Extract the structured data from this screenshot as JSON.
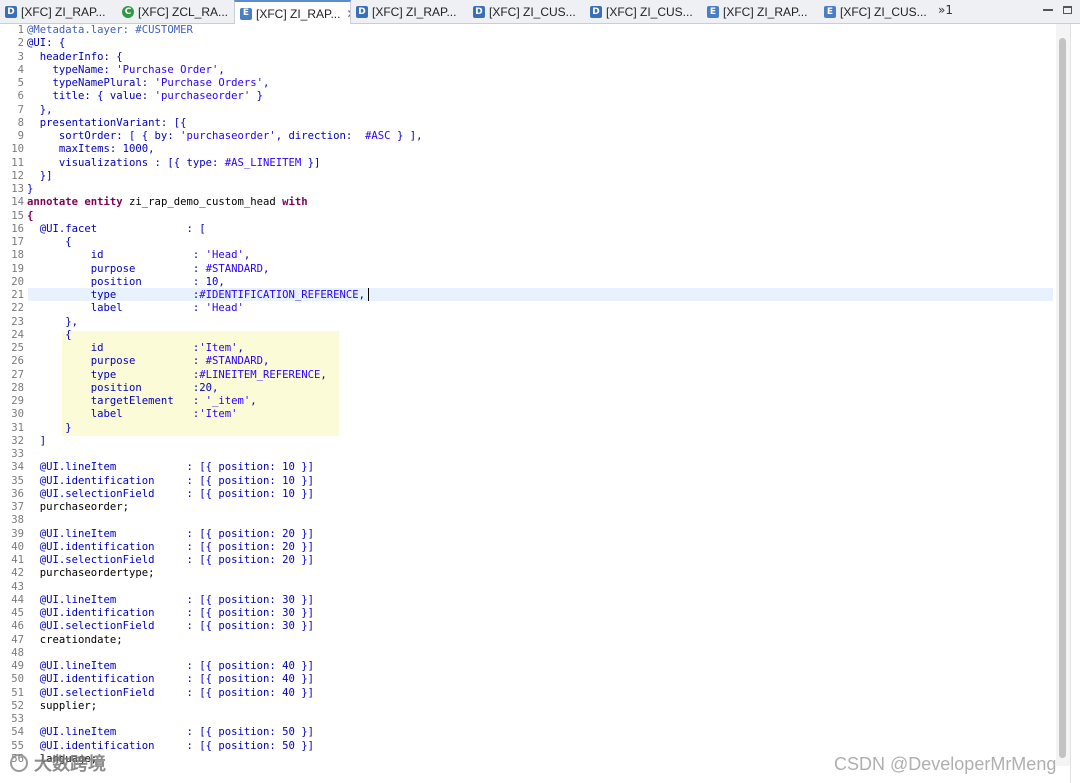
{
  "tabs": [
    {
      "kind": "d",
      "icon": "ddl-source-icon",
      "label": "[XFC] ZI_RAP...",
      "active": false
    },
    {
      "kind": "c",
      "icon": "class-icon",
      "label": "[XFC] ZCL_RA...",
      "active": false
    },
    {
      "kind": "e",
      "icon": "metadata-extension-icon",
      "label": "[XFC] ZI_RAP...",
      "active": true
    },
    {
      "kind": "d",
      "icon": "ddl-source-icon",
      "label": "[XFC] ZI_RAP...",
      "active": false
    },
    {
      "kind": "d",
      "icon": "ddl-source-icon",
      "label": "[XFC] ZI_CUS...",
      "active": false
    },
    {
      "kind": "d",
      "icon": "ddl-source-icon",
      "label": "[XFC] ZI_CUS...",
      "active": false
    },
    {
      "kind": "e",
      "icon": "metadata-extension-icon",
      "label": "[XFC] ZI_RAP...",
      "active": false
    },
    {
      "kind": "e",
      "icon": "metadata-extension-icon",
      "label": "[XFC] ZI_CUS...",
      "active": false
    }
  ],
  "tab_icon_letters": {
    "d": "D",
    "c": "C",
    "e": "E"
  },
  "tab_close_glyph": "✕",
  "tab_overflow": "»1",
  "editor": {
    "cursor_line": 21,
    "lines": [
      [
        {
          "t": "m",
          "s": "@Metadata.layer: #CUSTOMER"
        }
      ],
      [
        {
          "t": "a",
          "s": "@UI: {"
        }
      ],
      [
        {
          "t": "a",
          "s": "  headerInfo: {"
        }
      ],
      [
        {
          "t": "a",
          "s": "    typeName: "
        },
        {
          "t": "s",
          "s": "'Purchase Order'"
        },
        {
          "t": "a",
          "s": ","
        }
      ],
      [
        {
          "t": "a",
          "s": "    typeNamePlural: "
        },
        {
          "t": "s",
          "s": "'Purchase Orders'"
        },
        {
          "t": "a",
          "s": ","
        }
      ],
      [
        {
          "t": "a",
          "s": "    title: { value: "
        },
        {
          "t": "s",
          "s": "'purchaseorder'"
        },
        {
          "t": "a",
          "s": " }"
        }
      ],
      [
        {
          "t": "a",
          "s": "  },"
        }
      ],
      [
        {
          "t": "a",
          "s": "  presentationVariant: [{"
        }
      ],
      [
        {
          "t": "a",
          "s": "     sortOrder: [ { by: "
        },
        {
          "t": "s",
          "s": "'purchaseorder'"
        },
        {
          "t": "a",
          "s": ", direction:  "
        },
        {
          "t": "v",
          "s": "#ASC"
        },
        {
          "t": "a",
          "s": " } ],"
        }
      ],
      [
        {
          "t": "a",
          "s": "     maxItems: 1000,"
        }
      ],
      [
        {
          "t": "a",
          "s": "     visualizations : [{ type: "
        },
        {
          "t": "v",
          "s": "#AS_LINEITEM"
        },
        {
          "t": "a",
          "s": " }]"
        }
      ],
      [
        {
          "t": "a",
          "s": "  }]"
        }
      ],
      [
        {
          "t": "a",
          "s": "}"
        }
      ],
      [
        {
          "t": "k",
          "s": "annotate entity"
        },
        {
          "t": "n",
          "s": " zi_rap_demo_custom_head "
        },
        {
          "t": "k",
          "s": "with"
        }
      ],
      [
        {
          "t": "k",
          "s": "{"
        }
      ],
      [
        {
          "t": "a",
          "s": "  @UI.facet              : ["
        }
      ],
      [
        {
          "t": "a",
          "s": "      {"
        }
      ],
      [
        {
          "t": "a",
          "s": "          id              : "
        },
        {
          "t": "s",
          "s": "'Head'"
        },
        {
          "t": "a",
          "s": ","
        }
      ],
      [
        {
          "t": "a",
          "s": "          purpose         : "
        },
        {
          "t": "v",
          "s": "#STANDARD"
        },
        {
          "t": "a",
          "s": ","
        }
      ],
      [
        {
          "t": "a",
          "s": "          position        : 10,"
        }
      ],
      [
        {
          "t": "a",
          "s": "          type            :"
        },
        {
          "t": "v",
          "s": "#IDENTIFICATION_REFERENCE"
        },
        {
          "t": "a",
          "s": ","
        }
      ],
      [
        {
          "t": "a",
          "s": "          label           : "
        },
        {
          "t": "s",
          "s": "'Head'"
        }
      ],
      [
        {
          "t": "a",
          "s": "      },"
        }
      ],
      [
        {
          "t": "a",
          "s": "      {"
        }
      ],
      [
        {
          "t": "a",
          "s": "          id              :"
        },
        {
          "t": "s",
          "s": "'Item'"
        },
        {
          "t": "a",
          "s": ","
        }
      ],
      [
        {
          "t": "a",
          "s": "          purpose         : "
        },
        {
          "t": "v",
          "s": "#STANDARD"
        },
        {
          "t": "a",
          "s": ","
        }
      ],
      [
        {
          "t": "a",
          "s": "          type            :"
        },
        {
          "t": "v",
          "s": "#LINEITEM_REFERENCE"
        },
        {
          "t": "a",
          "s": ","
        }
      ],
      [
        {
          "t": "a",
          "s": "          position        :20,"
        }
      ],
      [
        {
          "t": "a",
          "s": "          targetElement   : "
        },
        {
          "t": "s",
          "s": "'_item'"
        },
        {
          "t": "a",
          "s": ","
        }
      ],
      [
        {
          "t": "a",
          "s": "          label           :"
        },
        {
          "t": "s",
          "s": "'Item'"
        }
      ],
      [
        {
          "t": "a",
          "s": "      }"
        }
      ],
      [
        {
          "t": "a",
          "s": "  ]"
        }
      ],
      [
        {
          "t": "a",
          "s": ""
        }
      ],
      [
        {
          "t": "a",
          "s": "  @UI.lineItem           : [{ position: 10 }]"
        }
      ],
      [
        {
          "t": "a",
          "s": "  @UI.identification     : [{ position: 10 }]"
        }
      ],
      [
        {
          "t": "a",
          "s": "  @UI.selectionField     : [{ position: 10 }]"
        }
      ],
      [
        {
          "t": "n",
          "s": "  purchaseorder;"
        }
      ],
      [
        {
          "t": "a",
          "s": ""
        }
      ],
      [
        {
          "t": "a",
          "s": "  @UI.lineItem           : [{ position: 20 }]"
        }
      ],
      [
        {
          "t": "a",
          "s": "  @UI.identification     : [{ position: 20 }]"
        }
      ],
      [
        {
          "t": "a",
          "s": "  @UI.selectionField     : [{ position: 20 }]"
        }
      ],
      [
        {
          "t": "n",
          "s": "  purchaseordertype;"
        }
      ],
      [
        {
          "t": "a",
          "s": ""
        }
      ],
      [
        {
          "t": "a",
          "s": "  @UI.lineItem           : [{ position: 30 }]"
        }
      ],
      [
        {
          "t": "a",
          "s": "  @UI.identification     : [{ position: 30 }]"
        }
      ],
      [
        {
          "t": "a",
          "s": "  @UI.selectionField     : [{ position: 30 }]"
        }
      ],
      [
        {
          "t": "n",
          "s": "  creationdate;"
        }
      ],
      [
        {
          "t": "a",
          "s": ""
        }
      ],
      [
        {
          "t": "a",
          "s": "  @UI.lineItem           : [{ position: 40 }]"
        }
      ],
      [
        {
          "t": "a",
          "s": "  @UI.identification     : [{ position: 40 }]"
        }
      ],
      [
        {
          "t": "a",
          "s": "  @UI.selectionField     : [{ position: 40 }]"
        }
      ],
      [
        {
          "t": "n",
          "s": "  supplier;"
        }
      ],
      [
        {
          "t": "a",
          "s": ""
        }
      ],
      [
        {
          "t": "a",
          "s": "  @UI.lineItem           : [{ position: 50 }]"
        }
      ],
      [
        {
          "t": "a",
          "s": "  @UI.identification     : [{ position: 50 }]"
        }
      ],
      [
        {
          "t": "n",
          "s": "  language;"
        }
      ]
    ]
  },
  "watermarks": {
    "left": "大数跨境",
    "right": "CSDN @DeveloperMrMeng"
  },
  "colors": {
    "keyword": "#7f0055",
    "annotation": "#0000c0",
    "string": "#2a00ff",
    "enum": "#2a00ff",
    "metadata": "#3f5fbf",
    "current_line": "#e8f2fe",
    "block_highlight": "#fbfbd7",
    "active_tab_accent": "#5b8bd0"
  }
}
